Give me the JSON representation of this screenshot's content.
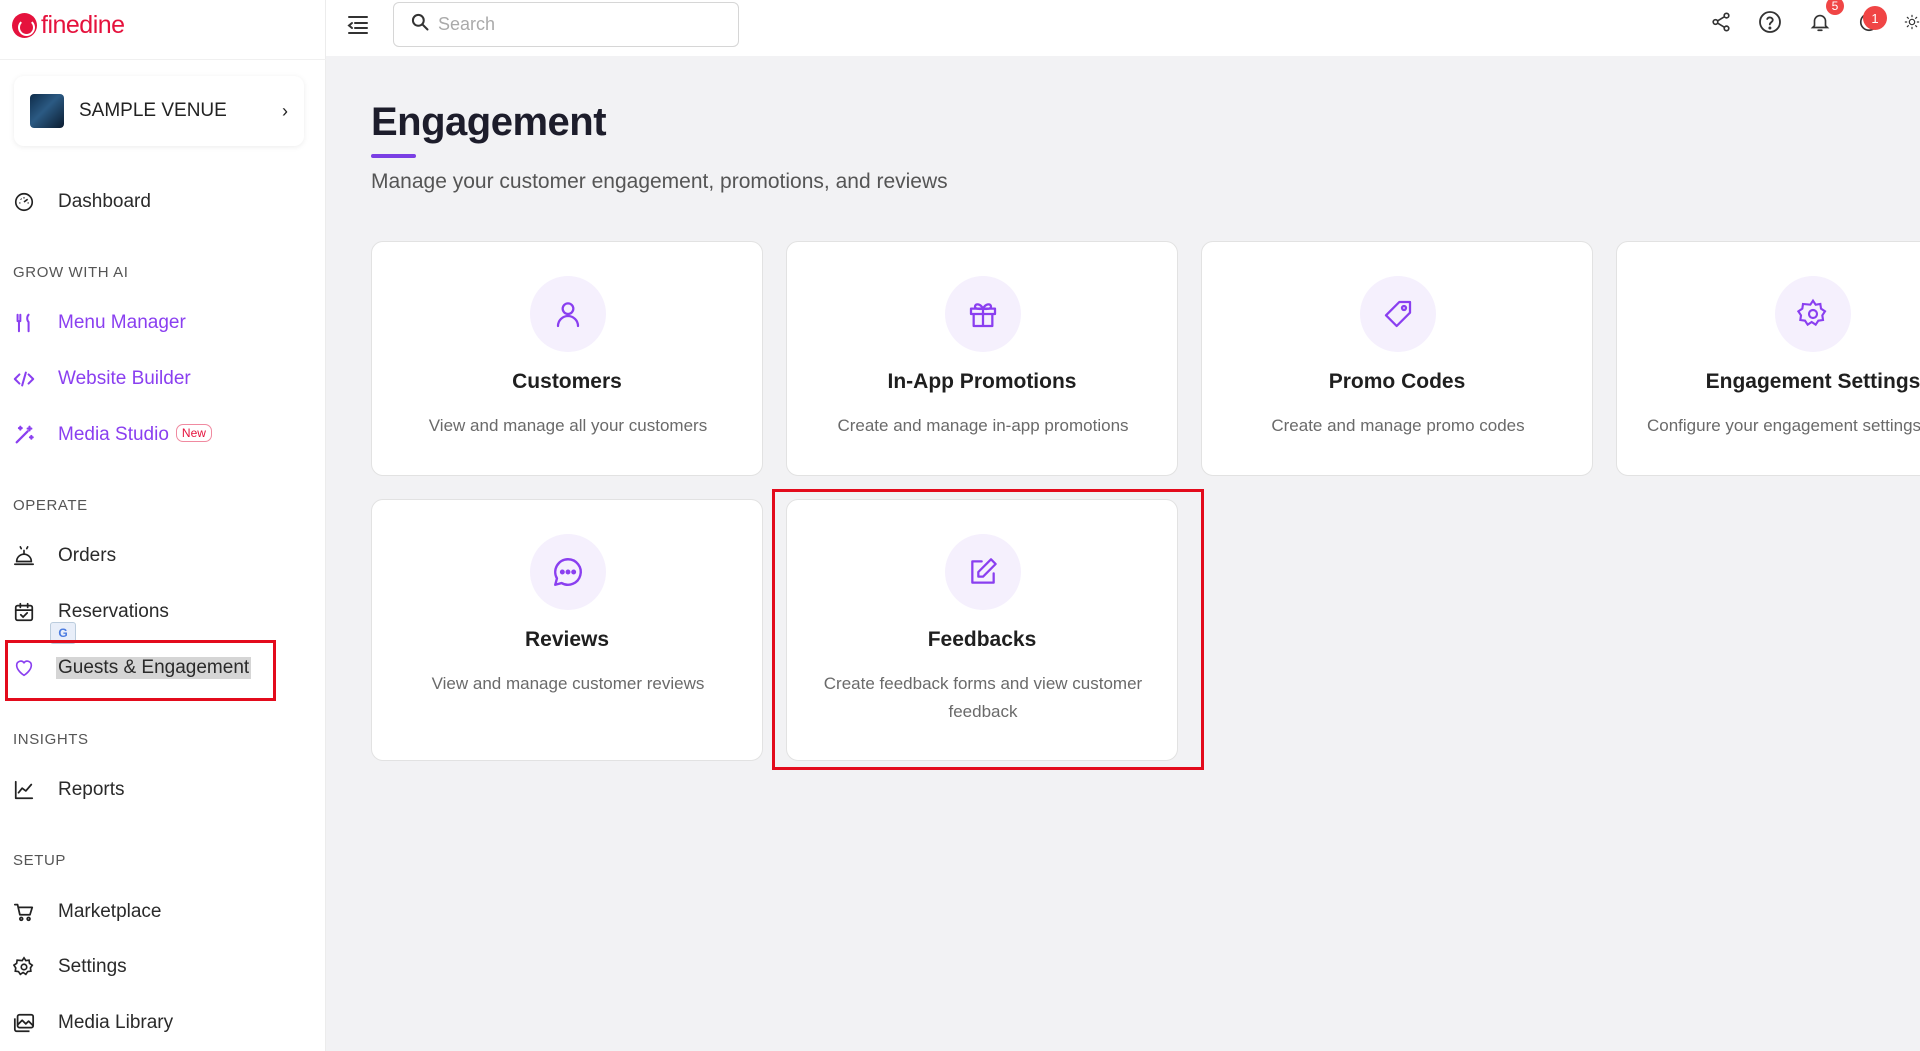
{
  "brand": {
    "name": "finedine"
  },
  "venue": {
    "name": "SAMPLE VENUE",
    "chevron": "›"
  },
  "sidebar": {
    "dashboard": "Dashboard",
    "sections": {
      "grow": "GROW WITH AI",
      "operate": "OPERATE",
      "insights": "INSIGHTS",
      "setup": "SETUP"
    },
    "items": {
      "menu_manager": "Menu Manager",
      "website_builder": "Website Builder",
      "media_studio": "Media Studio",
      "media_studio_badge": "New",
      "orders": "Orders",
      "reservations": "Reservations",
      "guests_engagement": "Guests & Engagement",
      "reports": "Reports",
      "marketplace": "Marketplace",
      "settings": "Settings",
      "media_library": "Media Library"
    },
    "translate_badge": "G"
  },
  "topbar": {
    "search_placeholder": "Search",
    "notifications_count": "5",
    "messages_count": "1"
  },
  "page": {
    "title": "Engagement",
    "subtitle": "Manage your customer engagement, promotions, and reviews"
  },
  "cards": {
    "customers": {
      "title": "Customers",
      "desc": "View and manage all your customers"
    },
    "promotions": {
      "title": "In-App Promotions",
      "desc": "Create and manage in-app promotions"
    },
    "promo_codes": {
      "title": "Promo Codes",
      "desc": "Create and manage promo codes"
    },
    "engagement_settings": {
      "title": "Engagement Settings",
      "desc": "Configure your engagement settings"
    },
    "reviews": {
      "title": "Reviews",
      "desc": "View and manage customer reviews"
    },
    "feedbacks": {
      "title": "Feedbacks",
      "desc": "Create feedback forms and view customer feedback"
    }
  },
  "colors": {
    "brand_red": "#e5123d",
    "accent_purple": "#8a3ff0",
    "highlight_box": "#e30b1c"
  }
}
